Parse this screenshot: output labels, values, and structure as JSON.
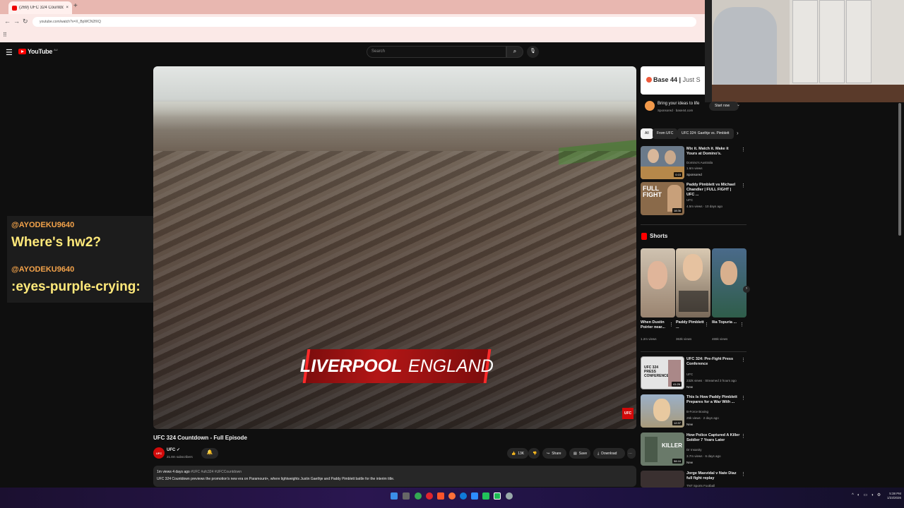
{
  "browser": {
    "tab_title": "(269) UFC 324 Countdown - F...",
    "url": "youtube.com/watch?v=X_BpWCN2fXQ",
    "new_tab": "+"
  },
  "header": {
    "logo_text": "YouTube",
    "country_code": "AU",
    "search_placeholder": "Search"
  },
  "video": {
    "lower_third_city": "LIVERPOOL",
    "lower_third_country": "ENGLAND",
    "bug": "UFC"
  },
  "info": {
    "title": "UFC 324 Countdown - Full Episode",
    "channel": "UFC",
    "subscribers": "21.8m subscribers",
    "likes": "13K",
    "share": "Share",
    "save": "Save",
    "download": "Download",
    "views_time": "1m views  4 days ago",
    "tags": "#UFC #ufc324 #UFCCountdown",
    "description": "UFC 324 Countdown previews the promotion's new era on Paramount+, where lightweights Justin Gaethje and Paddy Pimblett battle for the interim title."
  },
  "chat": [
    {
      "user": "@AYODEKU9640",
      "message": "Where's hw2?"
    },
    {
      "user": "@AYODEKU9640",
      "message": ":eyes-purple-crying:"
    }
  ],
  "sidebar": {
    "ad": {
      "banner_brand": "Base 44",
      "banner_rest": "Just S",
      "title": "Bring your ideas to life",
      "sponsor_line": "Sponsored · base44.com",
      "cta": "Start now"
    },
    "chips": [
      "All",
      "From UFC",
      "UFC 324: Gaethje vs. Pimblett"
    ],
    "recs_top": [
      {
        "title": "Mix it. Match it. Make it Yours at Domino's.",
        "channel": "Domino's Australia",
        "meta": "1.6m views",
        "badge": "Sponsored",
        "duration": "0:15",
        "color": "#6b7a8a"
      },
      {
        "title": "Paddy Pimblett vs Michael Chandler | FULL FIGHT | UFC ...",
        "channel": "UFC",
        "meta": "4.5m views · 10 days ago",
        "badge": "",
        "duration": "18:36",
        "color": "#8a6a4a",
        "overlay": "FULL FIGHT"
      }
    ],
    "shorts_label": "Shorts",
    "shorts": [
      {
        "title": "When Dustin Poirier near...",
        "views": "1.2m views",
        "color": "#9a8470"
      },
      {
        "title": "Paddy Pimblett ...",
        "views": "363k views",
        "color": "#b0a090"
      },
      {
        "title": "Ilia Topuria ...",
        "views": "465k views",
        "color": "#2f5d4a"
      }
    ],
    "recs_bottom": [
      {
        "title": "UFC 324: Pre-Fight Press Conference",
        "channel": "UFC",
        "meta": "232k views · Streamed 3 hours ago",
        "badge": "New",
        "duration": "41:26",
        "color": "#d8d8d8",
        "overlay": "UFC 324 PRESS CONFERENCE"
      },
      {
        "title": "This Is How Paddy Pimblett Prepares for a War With ...",
        "channel": "B-Force Boxing",
        "meta": "25k views · 2 days ago",
        "badge": "New",
        "duration": "12:37",
        "color": "#a89a7a"
      },
      {
        "title": "How Police Captured A Killer Soldier 7 Years Later",
        "channel": "Dr Insanity",
        "meta": "3.7m views · 6 days ago",
        "badge": "New",
        "duration": "58:16",
        "color": "#6a7a6a",
        "overlay": "KILLER"
      },
      {
        "title": "Jorge Masvidal v Nate Diaz full fight replay",
        "channel": "TNT Sports Football",
        "meta": "",
        "badge": "",
        "duration": "",
        "color": "#3a3030"
      }
    ]
  },
  "taskbar": {
    "time": "5:38 PM",
    "date": "1/23/2026"
  }
}
